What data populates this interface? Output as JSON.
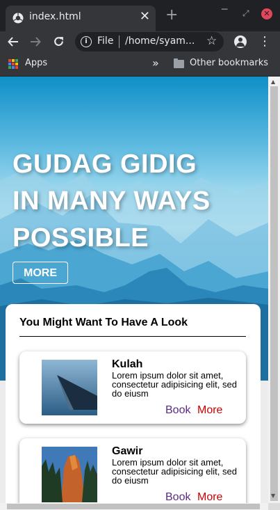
{
  "browser": {
    "tab_title": "index.html",
    "tab_close": "✕",
    "new_tab": "+",
    "window_min": "─",
    "window_max": "⤢",
    "window_close": "✕",
    "address_scheme": "File",
    "address_url": "/home/syam...",
    "bookmarks": {
      "apps_label": "Apps",
      "overflow": "»",
      "other_label": "Other bookmarks"
    },
    "icons": [
      "chrome-icon",
      "back-icon",
      "forward-icon",
      "reload-icon",
      "info-icon",
      "star-icon",
      "profile-icon",
      "menu-icon",
      "apps-icon",
      "folder-icon"
    ]
  },
  "hero": {
    "title_lines": [
      "GUDAG GIDIG",
      "IN MANY WAYS",
      "POSSIBLE"
    ],
    "button_label": "MORE"
  },
  "section": {
    "title": "You Might Want To Have A Look",
    "items": [
      {
        "name": "Kulah",
        "description": "Lorem ipsum dolor sit amet, consectetur adipisicing elit, sed do eiusm",
        "book_label": "Book",
        "more_label": "More"
      },
      {
        "name": "Gawir",
        "description": "Lorem ipsum dolor sit amet, consectetur adipisicing elit, sed do eiusm",
        "book_label": "Book",
        "more_label": "More"
      }
    ]
  },
  "colors": {
    "book_link": "#5b2a86",
    "more_link": "#cc0000",
    "chrome_dark": "#202124",
    "chrome_toolbar": "#35363a"
  }
}
